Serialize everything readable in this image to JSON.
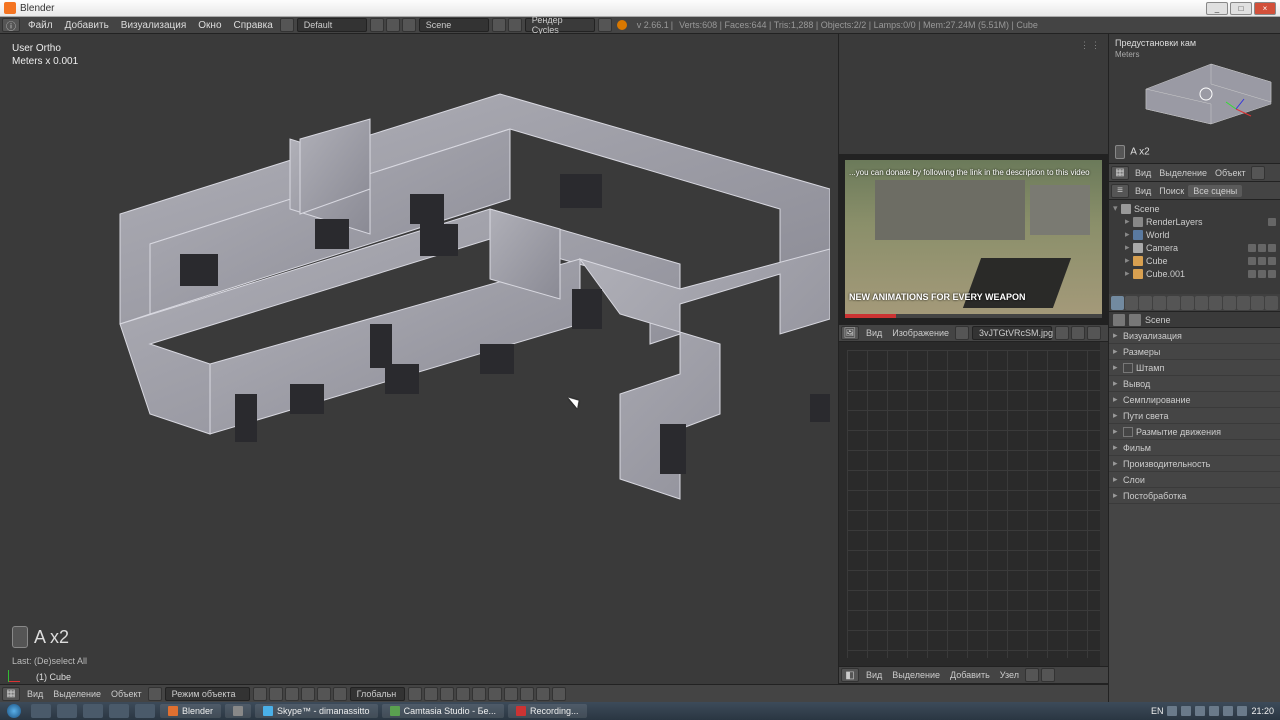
{
  "app": {
    "title": "Blender"
  },
  "window_controls": {
    "min": "_",
    "max": "□",
    "close": "×"
  },
  "menu": {
    "file": "Файл",
    "add": "Добавить",
    "render": "Визуализация",
    "window": "Окно",
    "help": "Справка"
  },
  "header": {
    "layout_dropdown": "Default",
    "scene_dropdown": "Scene",
    "engine_dropdown": "Рендер Cycles",
    "version": "v 2.66.1",
    "stats": "Verts:608 | Faces:644 | Tris:1,288 | Objects:2/2 | Lamps:0/0 | Mem:27.24M (5.51M) | Cube"
  },
  "viewport": {
    "info_line1": "User Ortho",
    "info_line2": "Meters x 0.001",
    "keycast": "A x2",
    "last_op": "Last: (De)select All",
    "obj_name": "(1) Cube"
  },
  "vp_header": {
    "view": "Вид",
    "select": "Выделение",
    "object": "Объект",
    "mode": "Режим объекта",
    "orientation": "Глобальн"
  },
  "uv_header": {
    "view": "Вид",
    "image": "Изображение",
    "filename": "3vJTGtVRcSM.jpg"
  },
  "uv_header2": {
    "view": "Вид",
    "select": "Выделение",
    "add": "Добавить",
    "node": "Узел"
  },
  "video": {
    "top_text": "...you can donate by following the link in the description to this video",
    "caption": "NEW ANIMATIONS FOR EVERY WEAPON"
  },
  "preview": {
    "title": "Предустановки кам",
    "sub": "Meters",
    "keycast": "A x2"
  },
  "outliner_header": {
    "view": "Вид",
    "search": "Поиск",
    "tab": "Все сцены"
  },
  "outliner": {
    "scene": "Scene",
    "renderlayers": "RenderLayers",
    "world": "World",
    "camera": "Camera",
    "cube": "Cube",
    "cube001": "Cube.001"
  },
  "prop_context": {
    "scene": "Scene"
  },
  "panels": [
    "Визуализация",
    "Размеры",
    "Штамп",
    "Вывод",
    "Семплирование",
    "Пути света",
    "Размытие движения",
    "Фильм",
    "Производительность",
    "Слои",
    "Постобработка"
  ],
  "taskbar": {
    "blender": "Blender",
    "skype": "Skype™ - dimanassitto",
    "camtasia": "Camtasia Studio - Бе...",
    "recording": "Recording...",
    "lang": "EN",
    "time": "21:20"
  }
}
